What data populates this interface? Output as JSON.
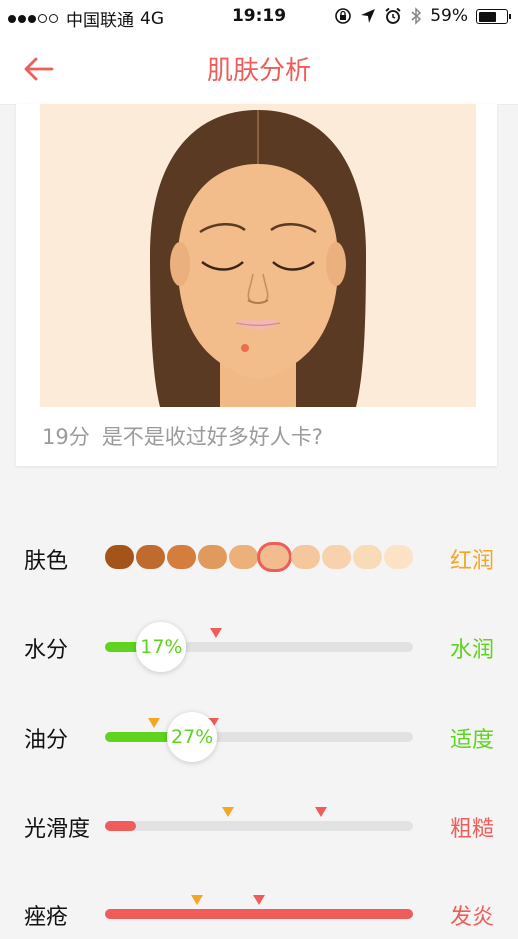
{
  "status_bar": {
    "carrier": "中国联通",
    "network": "4G",
    "time": "19:19",
    "battery": "59%"
  },
  "nav": {
    "title": "肌肤分析"
  },
  "card": {
    "score": "19分",
    "message": "是不是收过好多好人卡?"
  },
  "metrics": {
    "skin_color": {
      "label": "肤色",
      "status": "红润",
      "status_color": "#f5a623",
      "swatches": [
        "#a55419",
        "#bf6b2d",
        "#d47d3e",
        "#e09a5e",
        "#ecb07b",
        "#f2bc8e",
        "#f5c79d",
        "#f8d2ad",
        "#fadbb8",
        "#fce3c5"
      ],
      "selected_index": 5
    },
    "moisture": {
      "label": "水分",
      "value_text": "17%",
      "value": 0.17,
      "status": "水润",
      "status_color": "#5fd31d",
      "fill_color": "#5fd31d",
      "marker_yellow": 0.16,
      "marker_red": 0.36
    },
    "oil": {
      "label": "油分",
      "value_text": "27%",
      "value": 0.27,
      "status": "适度",
      "status_color": "#5fd31d",
      "fill_color": "#5fd31d",
      "marker_yellow": 0.16,
      "marker_red": 0.35
    },
    "smoothness": {
      "label": "光滑度",
      "status": "粗糙",
      "status_color": "#ef5d5a",
      "fill_color": "#ef5d5a",
      "value": 0.1,
      "marker_yellow": 0.4,
      "marker_red": 0.7
    },
    "acne": {
      "label": "痤疮",
      "status": "发炎",
      "status_color": "#ef5d5a",
      "fill_color": "#ef5d5a",
      "value": 1.0,
      "marker_yellow": 0.3,
      "marker_red": 0.5
    }
  }
}
